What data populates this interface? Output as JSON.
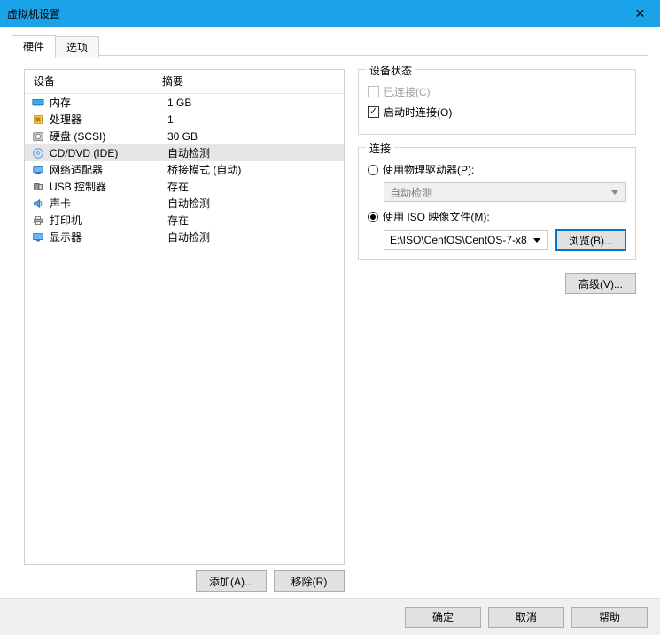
{
  "window": {
    "title": "虚拟机设置"
  },
  "tabs": {
    "hardware": "硬件",
    "options": "选项"
  },
  "list": {
    "hdr_device": "设备",
    "hdr_summary": "摘要",
    "items": [
      {
        "id": "memory",
        "label": "内存",
        "summary": "1 GB"
      },
      {
        "id": "cpu",
        "label": "处理器",
        "summary": "1"
      },
      {
        "id": "disk",
        "label": "硬盘 (SCSI)",
        "summary": "30 GB"
      },
      {
        "id": "cddvd",
        "label": "CD/DVD (IDE)",
        "summary": "自动检测",
        "selected": true
      },
      {
        "id": "net",
        "label": "网络适配器",
        "summary": "桥接模式 (自动)"
      },
      {
        "id": "usb",
        "label": "USB 控制器",
        "summary": "存在"
      },
      {
        "id": "sound",
        "label": "声卡",
        "summary": "自动检测"
      },
      {
        "id": "printer",
        "label": "打印机",
        "summary": "存在"
      },
      {
        "id": "display",
        "label": "显示器",
        "summary": "自动检测"
      }
    ]
  },
  "buttons": {
    "add": "添加(A)...",
    "remove": "移除(R)",
    "browse": "浏览(B)...",
    "advanced": "高级(V)...",
    "ok": "确定",
    "cancel": "取消",
    "help": "帮助"
  },
  "status": {
    "group": "设备状态",
    "connected": "已连接(C)",
    "connect_at_power_on": "启动时连接(O)"
  },
  "connection": {
    "group": "连接",
    "use_physical": "使用物理驱动器(P):",
    "physical_value": "自动检测",
    "use_iso": "使用 ISO 映像文件(M):",
    "iso_path": "E:\\ISO\\CentOS\\CentOS-7-x8"
  }
}
